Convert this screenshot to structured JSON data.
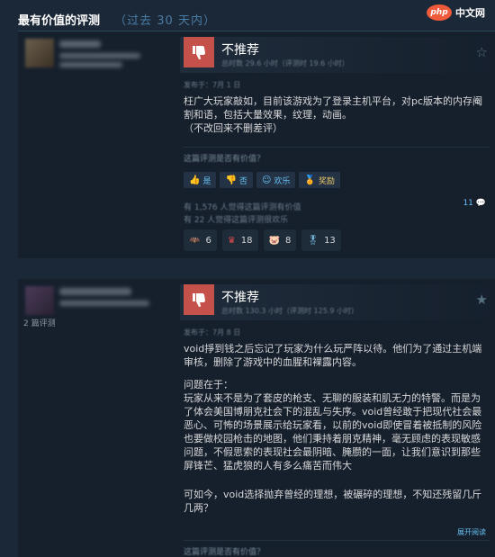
{
  "header": {
    "title": "最有价值的评测",
    "range": "（过去 30 天内）"
  },
  "logo": {
    "mark": "php",
    "text": "中文网"
  },
  "reviews": [
    {
      "verdict": "不推荐",
      "hours": "总时数 29.6 小时（评测时 19.6 小时）",
      "posted": "发布于：7月 1 日",
      "body": "枉广大玩家敲如，目前该游戏为了登录主机平台，对pc版本的内存阉割和语，包括大量效果，纹理，动画。\n（不改回来不删差评）",
      "helpful_question": "这篇评测是否有价值？",
      "buttons": [
        {
          "icon": "thumb-up-icon",
          "label": "是"
        },
        {
          "icon": "thumb-down-icon",
          "label": "否"
        },
        {
          "icon": "smile-icon",
          "label": "欢乐"
        },
        {
          "icon": "award-icon",
          "label": "奖励"
        }
      ],
      "stat_helpful": "有 1,576 人觉得这篇评测有价值",
      "stat_funny": "有 22 人觉得这篇评测很欢乐",
      "comments": "11",
      "awards": [
        {
          "icon": "bat-award-icon",
          "count": "6"
        },
        {
          "icon": "crown-award-icon",
          "count": "18"
        },
        {
          "icon": "pig-award-icon",
          "count": "8"
        },
        {
          "icon": "medal-award-icon",
          "count": "13"
        }
      ]
    },
    {
      "verdict": "不推荐",
      "hours": "总时数 130.3 小时（评测时 125.9 小时）",
      "posted": "发布于：7月 8 日",
      "author_note": "2 篇评测",
      "body_p1": "void掙到钱之后忘记了玩家为什么玩严阵以待。他们为了通过主机端审核，删除了游戏中的血腥和裸露内容。",
      "body_p2": "问题在于：\n玩家从来不是为了套皮的枪支、无聊的服装和肌无力的特警。而是为了体会美国博朋克社会下的混乱与失序。void曾经敢于把现代社会最恶心、可怖的场景展示给玩家看，以前的void即使冒着被抵制的风险也要做校园枪击的地图，他们秉持着朋克精神，毫无顾虑的表现敏感问题，不假思索的表现社会最阴暗、腌臜的一面，让我们意识到那些屏锋芒、猛虎狼的人有多么痛苦而伟大",
      "body_p3": "可如今，void选择抛弃曾经的理想，被碾碎的理想，不知还残留几斤几两？",
      "expand": "展开阅读",
      "helpful_question": "这篇评测是否有价值？"
    }
  ],
  "colors": {
    "background": "#1b2838",
    "card": "#16202d",
    "thumb_down": "#c4524a",
    "link": "#67c1f5"
  }
}
